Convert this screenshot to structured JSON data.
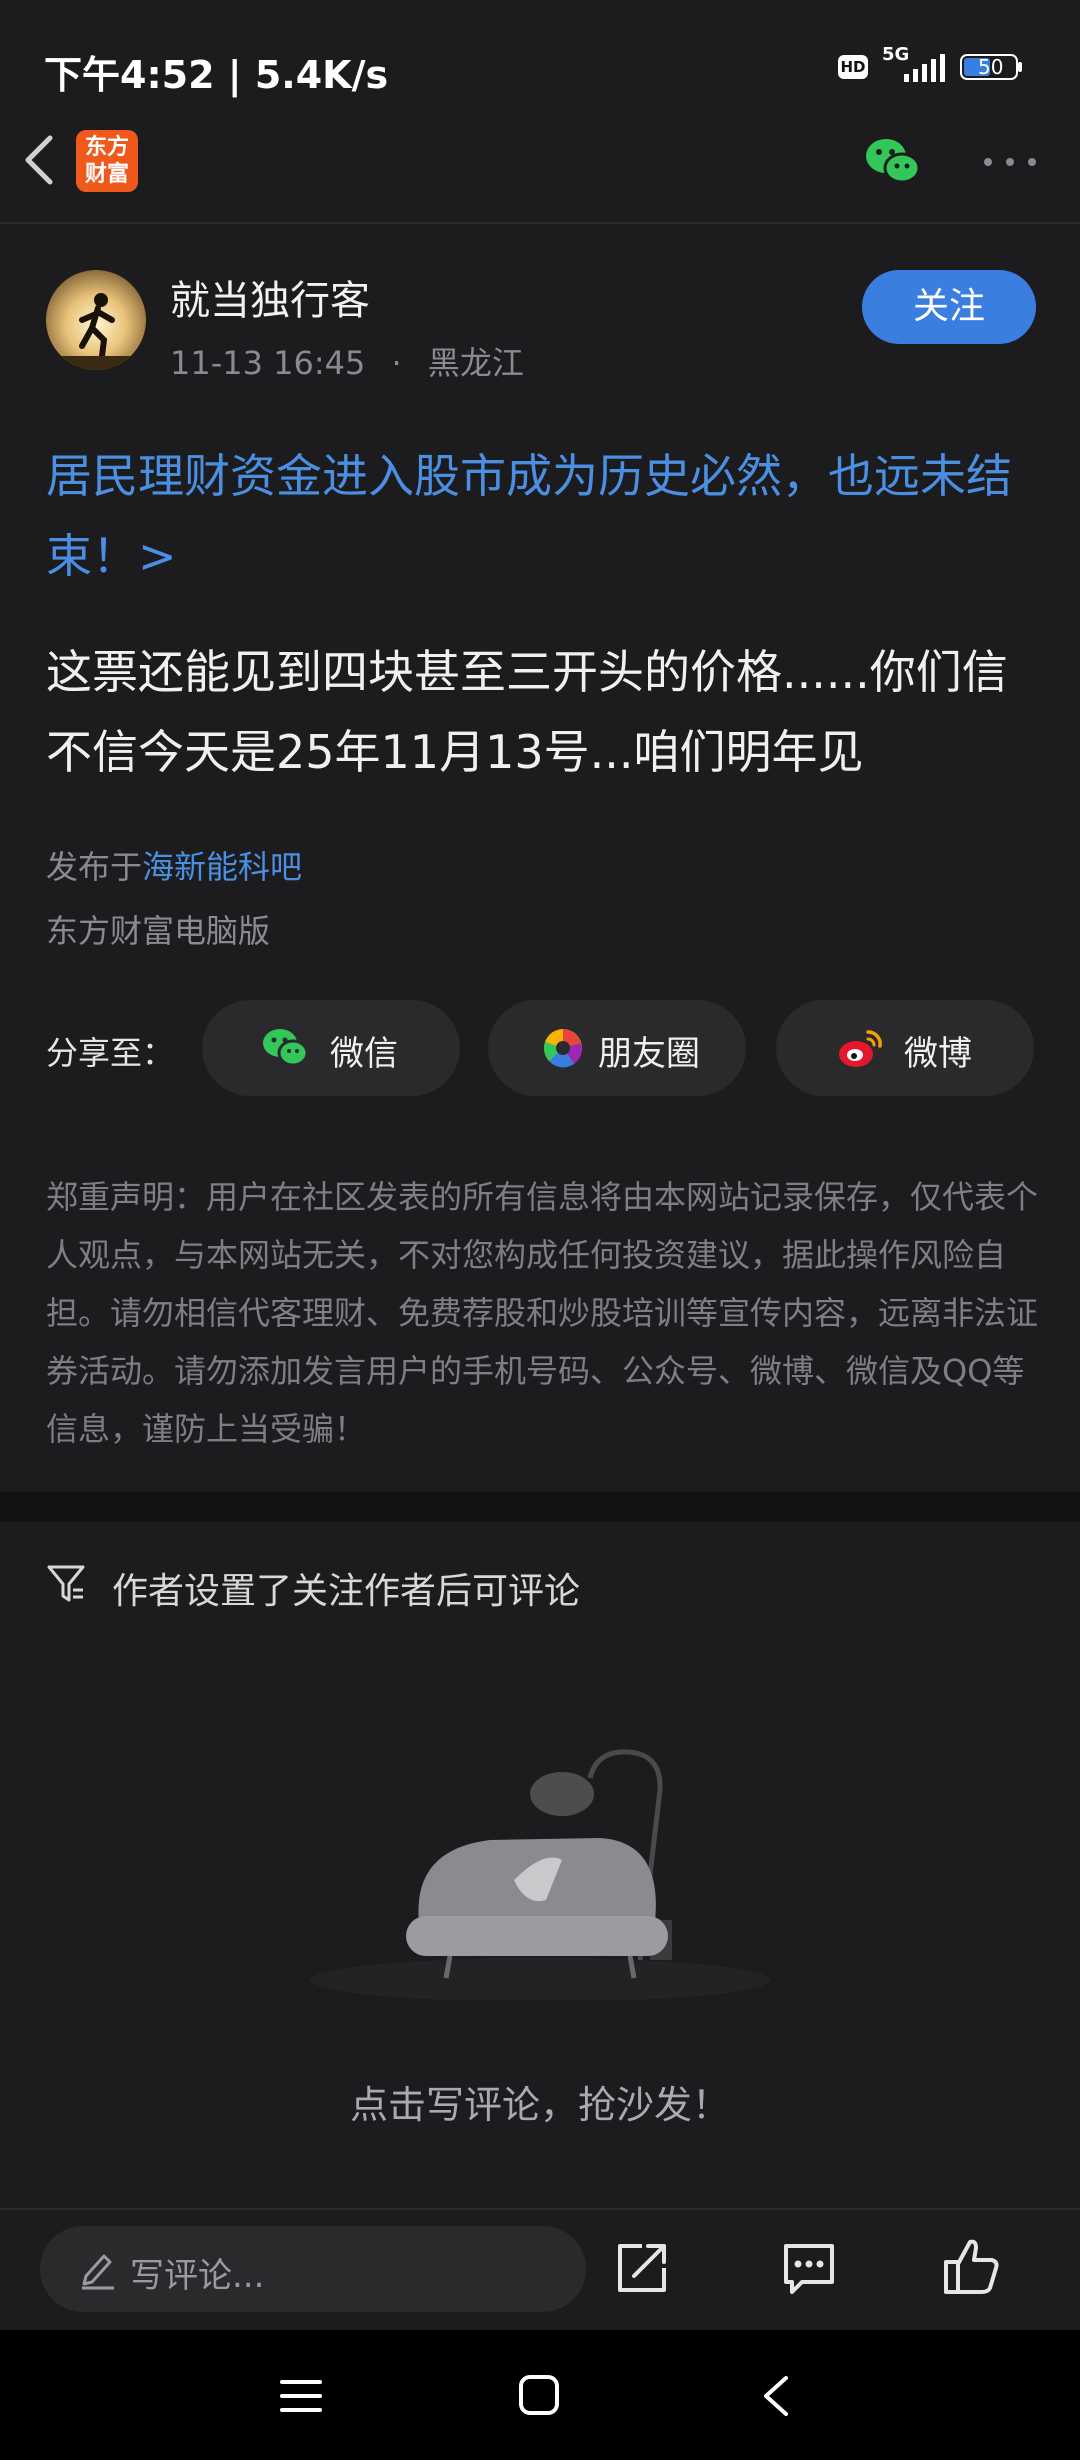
{
  "status_bar": {
    "time_speed": "下午4:52 | 5.4K/s",
    "hd_label": "HD",
    "network": "5G",
    "battery": "50"
  },
  "nav": {
    "app_logo_line1": "东方",
    "app_logo_line2": "财富"
  },
  "author": {
    "name": "就当独行客",
    "date": "11-13 16:45",
    "separator": "·",
    "location": "黑龙江",
    "follow_label": "关注"
  },
  "post": {
    "title": "居民理财资金进入股市成为历史必然，也远未结束！>",
    "body": "这票还能见到四块甚至三开头的价格......你们信不信今天是25年11月13号...咱们明年见",
    "published_prefix": "发布于",
    "bar_name": "海新能科吧",
    "platform": "东方财富电脑版"
  },
  "share": {
    "label": "分享至：",
    "buttons": [
      {
        "label": "微信",
        "icon": "wechat-icon"
      },
      {
        "label": "朋友圈",
        "icon": "moments-icon"
      },
      {
        "label": "微博",
        "icon": "weibo-icon"
      }
    ]
  },
  "disclaimer": "郑重声明：用户在社区发表的所有信息将由本网站记录保存，仅代表个人观点，与本网站无关，不对您构成任何投资建议，据此操作风险自担。请勿相信代客理财、免费荐股和炒股培训等宣传内容，远离非法证券活动。请勿添加发言用户的手机号码、公众号、微博、微信及QQ等信息，谨防上当受骗！",
  "comments": {
    "notice": "作者设置了关注作者后可评论",
    "empty_text": "点击写评论，抢沙发！"
  },
  "toolbar": {
    "comment_placeholder": "写评论..."
  },
  "colors": {
    "background": "#1c1c1e",
    "accent_blue": "#3a7ee0",
    "link_blue": "#4a8fe2",
    "logo_orange": "#ef5a1c",
    "wechat_green": "#33c759"
  }
}
